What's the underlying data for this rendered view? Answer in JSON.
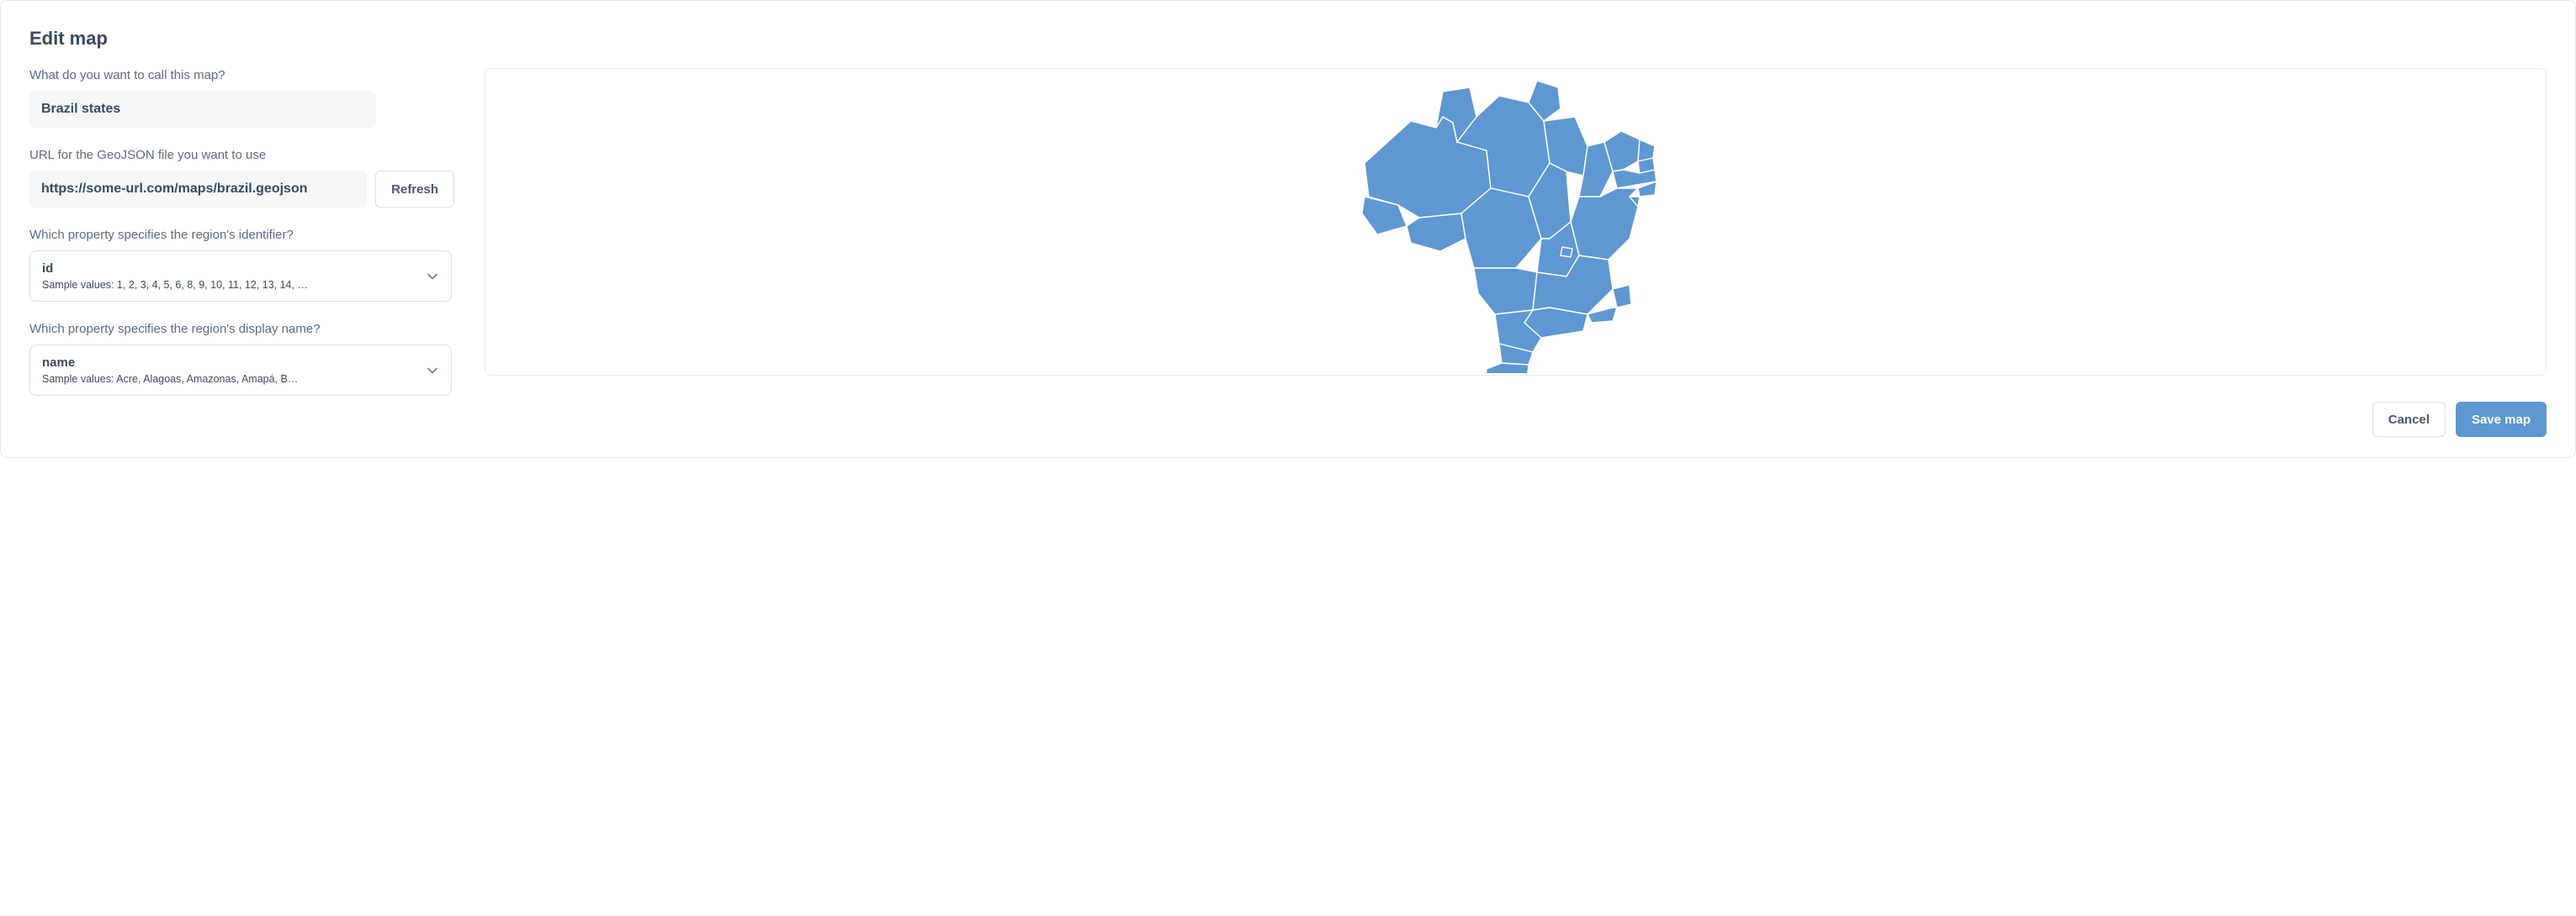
{
  "title": "Edit map",
  "fields": {
    "name": {
      "label": "What do you want to call this map?",
      "value": "Brazil states"
    },
    "url": {
      "label": "URL for the GeoJSON file you want to use",
      "value": "https://some-url.com/maps/brazil.geojson",
      "refresh_label": "Refresh"
    },
    "identifier": {
      "label": "Which property specifies the region's identifier?",
      "value": "id",
      "sample": "Sample values: 1, 2, 3, 4, 5, 6, 8, 9, 10, 11, 12, 13, 14, …"
    },
    "display_name": {
      "label": "Which property specifies the region's display name?",
      "value": "name",
      "sample": "Sample values: Acre, Alagoas, Amazonas, Amapá, B…"
    }
  },
  "footer": {
    "cancel": "Cancel",
    "save": "Save map"
  },
  "colors": {
    "map_fill": "#5e97d1",
    "map_stroke": "#ffffff"
  }
}
